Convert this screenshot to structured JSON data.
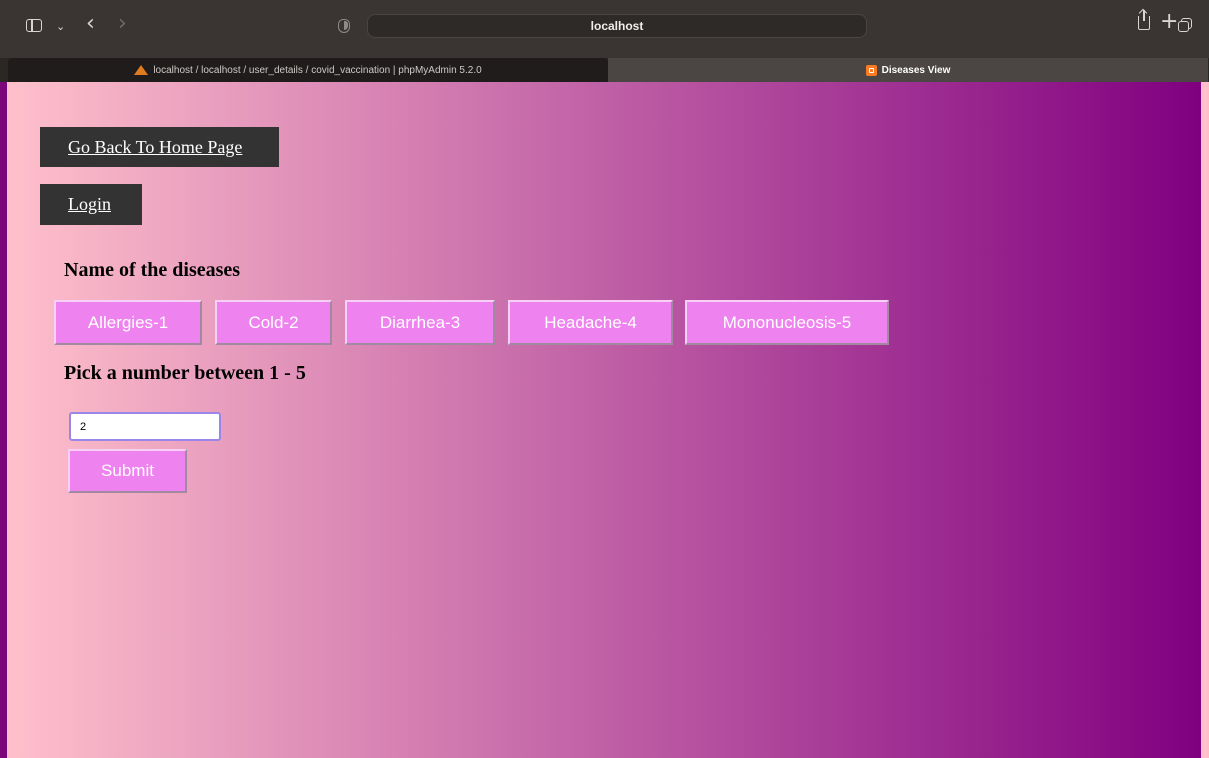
{
  "browser": {
    "address": "localhost",
    "tabs": [
      {
        "title": "localhost / localhost / user_details / covid_vaccination | phpMyAdmin 5.2.0"
      },
      {
        "title": "Diseases View"
      }
    ]
  },
  "nav": {
    "home_label": "Go Back To Home Page",
    "login_label": "Login"
  },
  "main": {
    "diseases_heading": "Name of the diseases",
    "diseases": [
      "Allergies-1",
      "Cold-2",
      "Diarrhea-3",
      "Headache-4",
      "Mononucleosis-5"
    ],
    "pick_heading": "Pick a number between 1 - 5",
    "number_value": "2",
    "submit_label": "Submit"
  },
  "colors": {
    "gradient_start": "#ffc0cb",
    "gradient_end": "#800080",
    "button_bg": "#ee82ee",
    "nav_bg": "#333333"
  },
  "icons": {
    "toolbar": [
      "sidebar-icon",
      "chevron-down-icon",
      "back-icon",
      "forward-icon",
      "shield-icon",
      "reload-icon",
      "share-icon",
      "plus-icon",
      "tabs-icon"
    ],
    "tab_favicons": [
      "phpmyadmin-icon",
      "xampp-icon"
    ]
  }
}
